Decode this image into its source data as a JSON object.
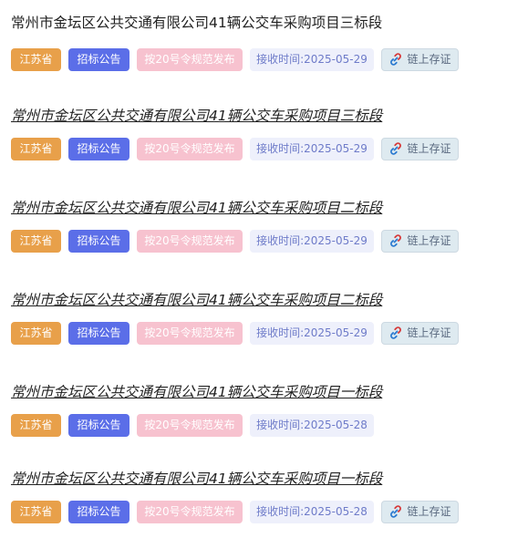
{
  "items": [
    {
      "title": "常州市金坛区公共交通有限公司41辆公交车采购项目三标段",
      "province": "江苏省",
      "type": "招标公告",
      "rule": "按20号令规范发布",
      "time": "接收时间:2025-05-29",
      "chain": "链上存证"
    },
    {
      "title": "常州市金坛区公共交通有限公司41辆公交车采购项目三标段",
      "province": "江苏省",
      "type": "招标公告",
      "rule": "按20号令规范发布",
      "time": "接收时间:2025-05-29",
      "chain": "链上存证"
    },
    {
      "title": "常州市金坛区公共交通有限公司41辆公交车采购项目二标段",
      "province": "江苏省",
      "type": "招标公告",
      "rule": "按20号令规范发布",
      "time": "接收时间:2025-05-29",
      "chain": "链上存证"
    },
    {
      "title": "常州市金坛区公共交通有限公司41辆公交车采购项目二标段",
      "province": "江苏省",
      "type": "招标公告",
      "rule": "按20号令规范发布",
      "time": "接收时间:2025-05-29",
      "chain": "链上存证"
    },
    {
      "title": "常州市金坛区公共交通有限公司41辆公交车采购项目一标段",
      "province": "江苏省",
      "type": "招标公告",
      "rule": "按20号令规范发布",
      "time": "接收时间:2025-05-28",
      "chain": ""
    },
    {
      "title": "常州市金坛区公共交通有限公司41辆公交车采购项目一标段",
      "province": "江苏省",
      "type": "招标公告",
      "rule": "按20号令规范发布",
      "time": "接收时间:2025-05-28",
      "chain": "链上存证"
    }
  ],
  "colors": {
    "province": "#e8a04a",
    "type": "#5b6ee8",
    "rule": "#f7c2cf",
    "time_bg": "#eef0fb",
    "chain_bg": "#deeaf0"
  },
  "icons": {
    "chain": "link-icon"
  }
}
